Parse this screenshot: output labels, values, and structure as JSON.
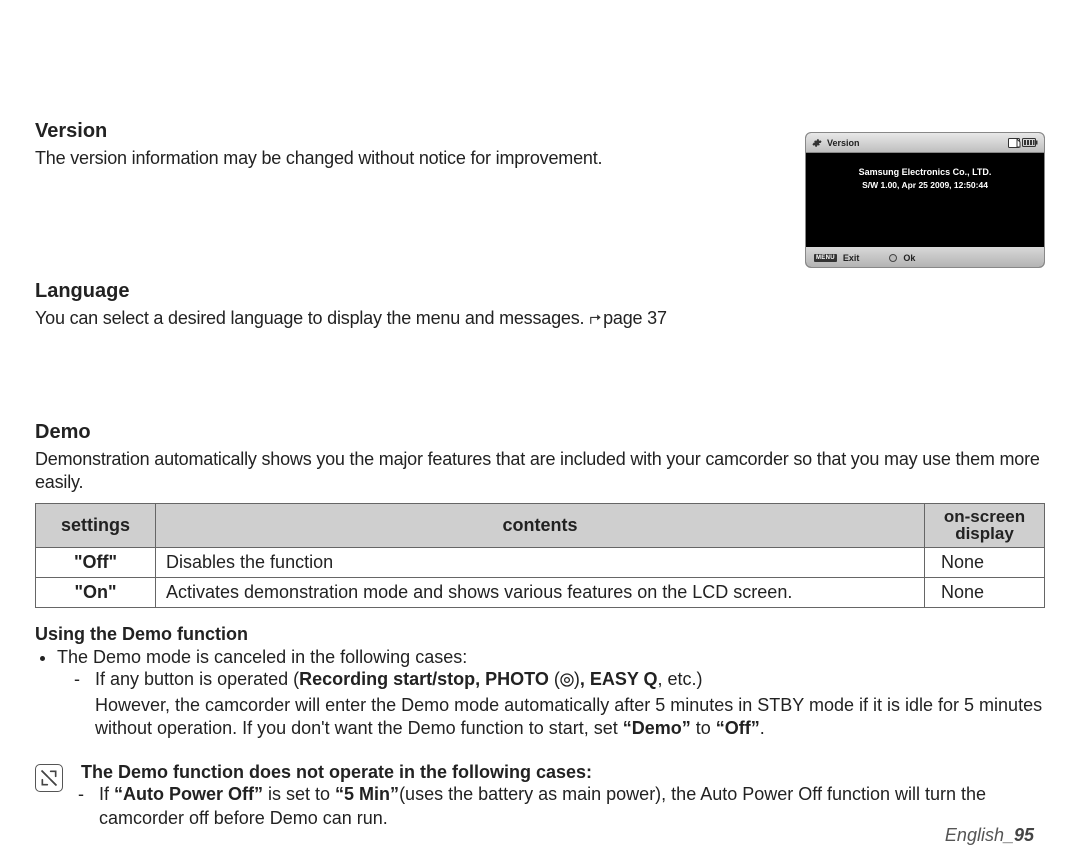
{
  "version": {
    "heading": "Version",
    "body": "The version information may be changed without notice for improvement."
  },
  "language": {
    "heading": "Language",
    "body_pre": "You can select a desired language to display the menu and messages. ",
    "body_post": "page 37"
  },
  "demo": {
    "heading": "Demo",
    "body": "Demonstration automatically shows you the major features that are included with your camcorder so that you may use them more easily."
  },
  "table": {
    "h1": "settings",
    "h2": "contents",
    "h3a": "on-screen",
    "h3b": "display",
    "r1c1": "\"Off\"",
    "r1c2": "Disables the function",
    "r1c3": "None",
    "r2c1": "\"On\"",
    "r2c2": "Activates demonstration mode and shows various features on the LCD screen.",
    "r2c3": "None"
  },
  "using": {
    "heading": "Using the Demo function",
    "bullet1": "The Demo mode is canceled in the following cases:",
    "dash1_pre": "If any button is operated (",
    "dash1_b1": "Recording start/stop, PHOTO",
    "dash1_mid": " (",
    "dash1_b2": ", EASY Q",
    "dash1_post": ", etc.)",
    "dash1_line2": "However, the camcorder will enter the Demo mode automatically after 5 minutes in STBY mode if it is idle for 5 minutes without operation. If you don't want the Demo function to start, set ",
    "dash1_q1": "“Demo”",
    "dash1_to": " to ",
    "dash1_q2": "“Off”",
    "dash1_end": "."
  },
  "note": {
    "heading": "The Demo function does not operate in the following cases:",
    "dash_pre": "If ",
    "dash_b1": "“Auto Power Off”",
    "dash_mid": " is set to ",
    "dash_b2": "“5 Min”",
    "dash_post": "(uses the battery as main power), the Auto Power Off function will turn the camcorder off before Demo can run."
  },
  "device": {
    "title": "Version",
    "line1": "Samsung Electronics Co., LTD.",
    "line2": "S/W 1.00, Apr 25 2009, 12:50:44",
    "menu": "MENU",
    "exit": "Exit",
    "ok": "Ok"
  },
  "footer": {
    "label": "English_",
    "page": "95"
  }
}
